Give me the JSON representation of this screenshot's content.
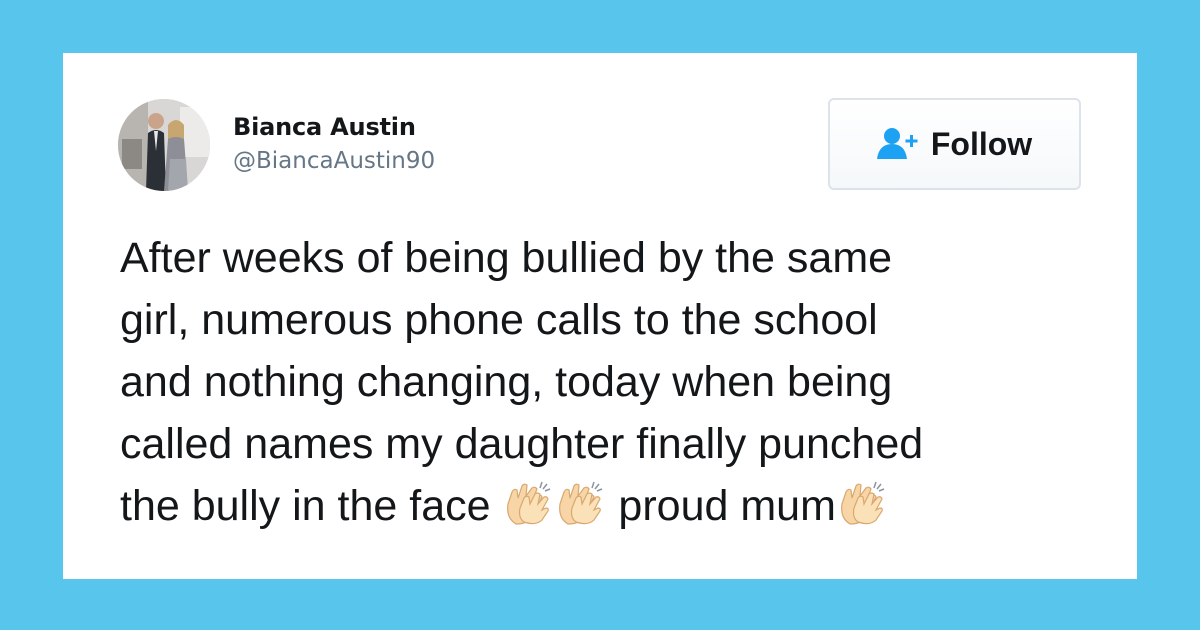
{
  "profile": {
    "name": "Bianca Austin",
    "handle": "@BiancaAustin90"
  },
  "follow_button": {
    "label": "Follow",
    "icon": "add-user-icon"
  },
  "tweet": {
    "lines": [
      "After weeks of being bullied by the same",
      "girl, numerous phone calls to the school",
      "and nothing changing, today when being",
      "called names my daughter finally punched"
    ],
    "last_line": {
      "before": "the bully in the face ",
      "between": " proud mum",
      "emoji_name": "clapping-hands-icon"
    }
  },
  "colors": {
    "background": "#58c6ec",
    "card": "#ffffff",
    "text": "#14171a",
    "handle": "#657786",
    "follow_icon": "#1da1f2"
  }
}
